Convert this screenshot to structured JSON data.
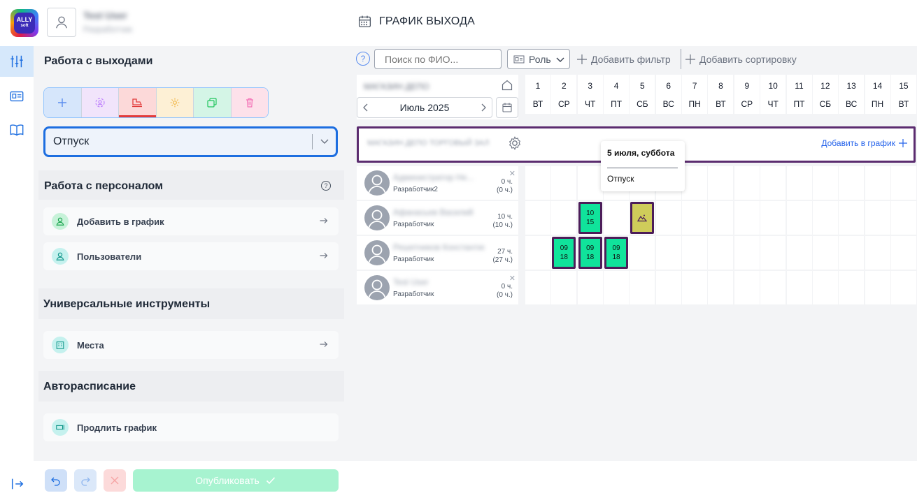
{
  "header": {
    "logo_text": "ALLY",
    "logo_sub": "soft",
    "user_name": "Test User",
    "user_role": "Разработчик",
    "page_title": "ГРАФИК ВЫХОДА"
  },
  "left_panel": {
    "section_shifts": {
      "title": "Работа с выходами"
    },
    "mode_select": {
      "value": "Отпуск"
    },
    "section_staff": {
      "title": "Работа с персоналом",
      "items": [
        {
          "label": "Добавить в график"
        },
        {
          "label": "Пользователи"
        }
      ]
    },
    "section_tools": {
      "title": "Универсальные инструменты",
      "items": [
        {
          "label": "Места"
        }
      ]
    },
    "section_auto": {
      "title": "Автора­списание",
      "items": [
        {
          "label": "Продлить график"
        }
      ]
    }
  },
  "bottom_bar": {
    "publish_label": "Опубликовать"
  },
  "filters": {
    "help": "?",
    "search_placeholder": "Поиск по ФИО...",
    "role_label": "Роль",
    "add_filter": "Добавить фильтр",
    "add_sort": "Добавить сортировку"
  },
  "calendar": {
    "department": "МАГАЗИН ДЕПО",
    "month": "Июль 2025",
    "days": [
      {
        "n": "1",
        "w": "ВТ"
      },
      {
        "n": "2",
        "w": "СР"
      },
      {
        "n": "3",
        "w": "ЧТ"
      },
      {
        "n": "4",
        "w": "ПТ"
      },
      {
        "n": "5",
        "w": "СБ"
      },
      {
        "n": "6",
        "w": "ВС"
      },
      {
        "n": "7",
        "w": "ПН"
      },
      {
        "n": "8",
        "w": "ВТ"
      },
      {
        "n": "9",
        "w": "СР"
      },
      {
        "n": "10",
        "w": "ЧТ"
      },
      {
        "n": "11",
        "w": "ПТ"
      },
      {
        "n": "12",
        "w": "СБ"
      },
      {
        "n": "13",
        "w": "ВС"
      },
      {
        "n": "14",
        "w": "ПН"
      },
      {
        "n": "15",
        "w": "ВТ"
      }
    ],
    "group": {
      "name": "МАГАЗИН ДЕПО ТОРГОВЫЙ ЗАЛ",
      "add_label": "Добавить в график"
    },
    "employees": [
      {
        "name": "Администратор Не...",
        "role": "Разработчик2",
        "hours": "0 ч.",
        "hours_total": "(0 ч.)",
        "shifts": []
      },
      {
        "name": "Афанасьев Василий",
        "role": "Разработчик",
        "hours": "10 ч.",
        "hours_total": "(10 ч.)",
        "shifts": [
          {
            "day": 3,
            "start": "10",
            "end": "15"
          }
        ],
        "vacation_days": [
          5
        ]
      },
      {
        "name": "Решетников Константин",
        "role": "Разработчик",
        "hours": "27 ч.",
        "hours_total": "(27 ч.)",
        "shifts": [
          {
            "day": 2,
            "start": "09",
            "end": "18"
          },
          {
            "day": 3,
            "start": "09",
            "end": "18"
          },
          {
            "day": 4,
            "start": "09",
            "end": "18"
          }
        ]
      },
      {
        "name": "Test User",
        "role": "Разработчик",
        "hours": "0 ч.",
        "hours_total": "(0 ч.)",
        "shifts": []
      }
    ],
    "tooltip": {
      "title": "5 июля, суббота",
      "body": "Отпуск"
    }
  },
  "colors": {
    "accent": "#1d6ee0",
    "shift_fill": "#10e39b",
    "vacation_fill": "#cfcc5a",
    "selection_border": "#5b2c6f"
  }
}
